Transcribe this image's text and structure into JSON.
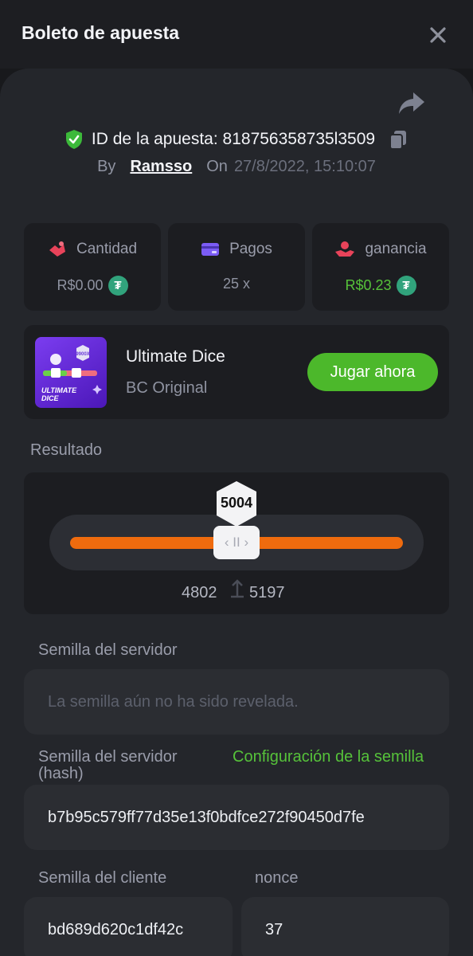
{
  "header": {
    "title": "Boleto de apuesta"
  },
  "bet": {
    "id_label": "ID de la apuesta: 818756358735l3509",
    "by_label": "By",
    "user": "Ramsso",
    "on_label": "On",
    "date": "27/8/2022, 15:10:07"
  },
  "stats": {
    "amount": {
      "label": "Cantidad",
      "value": "R$0.00"
    },
    "payout": {
      "label": "Pagos",
      "value": "25 x"
    },
    "profit": {
      "label": "ganancia",
      "value": "R$0.23"
    }
  },
  "game": {
    "name": "Ultimate Dice",
    "provider": "BC Original",
    "play_label": "Jugar ahora",
    "thumb_text": "ULTIMATE\nDICE",
    "thumb_badge": "9900X"
  },
  "result": {
    "label": "Resultado",
    "value": "5004",
    "range_low": "4802",
    "range_high": "5197",
    "handle_glyph": "‹ II ›"
  },
  "seeds": {
    "server_label": "Semilla del servidor",
    "server_placeholder": "La semilla aún no ha sido revelada.",
    "server_hash_label": "Semilla del servidor (hash)",
    "config_link": "Configuración de la semilla",
    "server_hash": "b7b95c579ff77d35e13f0bdfce272f90450d7fe",
    "client_label": "Semilla del cliente",
    "client_value": "bd689d620c1df42c",
    "nonce_label": "nonce",
    "nonce_value": "37"
  },
  "colors": {
    "accent_green": "#4cb82b",
    "slider_orange": "#ef6b0e",
    "coin_teal": "#31a37c",
    "amount_icon": "#e8435a",
    "payout_icon": "#7b5cf5",
    "profit_icon": "#e8435a"
  },
  "icons": {
    "close": "close-icon",
    "share": "share-icon",
    "shield": "shield-check-icon",
    "copy": "copy-icon",
    "amount": "money-hand-icon",
    "payout": "card-icon",
    "profit": "hand-coin-icon",
    "coin": "tether-coin-icon"
  }
}
